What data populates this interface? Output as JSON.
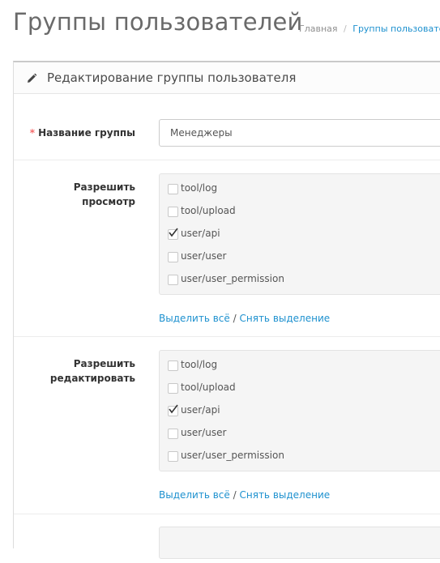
{
  "header": {
    "title": "Группы пользователей",
    "breadcrumb": [
      "Главная",
      "Группы пользователей"
    ]
  },
  "panel": {
    "title": "Редактирование группы пользователя",
    "icon": "pencil-icon"
  },
  "form": {
    "group_name": {
      "required_mark": "*",
      "label": "Название группы",
      "value": "Менеджеры"
    },
    "access": {
      "label_line1": "Разрешить",
      "label_line2": "просмотр",
      "items": [
        {
          "label": "tool/log",
          "checked": false
        },
        {
          "label": "tool/upload",
          "checked": false
        },
        {
          "label": "user/api",
          "checked": true
        },
        {
          "label": "user/user",
          "checked": false
        },
        {
          "label": "user/user_permission",
          "checked": false
        }
      ],
      "select_all": "Выделить всё",
      "separator": "/",
      "deselect": "Снять выделение"
    },
    "modify": {
      "label_line1": "Разрешить",
      "label_line2": "редактировать",
      "items": [
        {
          "label": "tool/log",
          "checked": false
        },
        {
          "label": "tool/upload",
          "checked": false
        },
        {
          "label": "user/api",
          "checked": true
        },
        {
          "label": "user/user",
          "checked": false
        },
        {
          "label": "user/user_permission",
          "checked": false
        }
      ],
      "select_all": "Выделить всё",
      "separator": "/",
      "deselect": "Снять выделение"
    }
  },
  "colors": {
    "link": "#1e91cf",
    "required": "#f56b6b",
    "well_bg": "#f5f5f5"
  }
}
